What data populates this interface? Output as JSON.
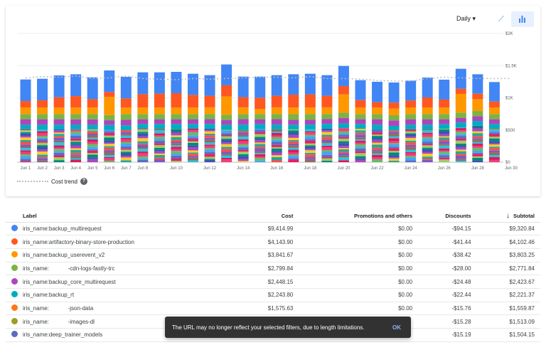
{
  "controls": {
    "granularity": "Daily",
    "line_view": "line-chart-icon",
    "bar_view": "bar-chart-icon",
    "active_view": "bar"
  },
  "chart_data": {
    "type": "bar",
    "stacked": true,
    "categories": [
      "Jun 1",
      "Jun 2",
      "Jun 3",
      "Jun 4",
      "Jun 5",
      "Jun 6",
      "Jun 7",
      "Jun 8",
      "Jun 9",
      "Jun 10",
      "Jun 11",
      "Jun 12",
      "Jun 13",
      "Jun 14",
      "Jun 15",
      "Jun 16",
      "Jun 17",
      "Jun 18",
      "Jun 19",
      "Jun 20",
      "Jun 21",
      "Jun 22",
      "Jun 23",
      "Jun 24",
      "Jun 25",
      "Jun 26",
      "Jun 27",
      "Jun 28",
      "Jun 29"
    ],
    "x_tick_labels": [
      "Jun 1",
      "Jun 2",
      "Jun 3",
      "Jun 4",
      "Jun 5",
      "Jun 6",
      "Jun 7",
      "Jun 8",
      "Jun 10",
      "Jun 12",
      "Jun 14",
      "Jun 16",
      "Jun 18",
      "Jun 20",
      "Jun 22",
      "Jun 24",
      "Jun 26",
      "Jun 28",
      "Jun 30"
    ],
    "y_ticks": [
      0,
      500,
      1000,
      1500,
      2000
    ],
    "y_tick_labels": [
      "$0",
      "$500",
      "$1K",
      "$1.5K",
      "$2K"
    ],
    "ylim": [
      0,
      2000
    ],
    "grid": true,
    "y_axis_side": "right",
    "series": [
      {
        "name": "iris_name:backup_multirequest",
        "color": "#4285f4",
        "values": [
          335,
          335,
          339,
          339,
          339,
          335,
          335,
          339,
          331,
          331,
          328,
          320,
          324,
          320,
          328,
          320,
          317,
          320,
          320,
          313,
          309,
          317,
          313,
          309,
          309,
          309,
          309,
          302,
          302
        ]
      },
      {
        "name": "iris_name:artifactory-binary-store-production",
        "color": "#ff5722",
        "values": [
          99,
          110,
          158,
          177,
          129,
          74,
          140,
          206,
          214,
          221,
          195,
          180,
          173,
          158,
          173,
          180,
          199,
          203,
          180,
          129,
          114,
          81,
          92,
          107,
          155,
          122,
          81,
          85,
          92
        ]
      },
      {
        "name": "iris_name:backup_userevent_v2",
        "color": "#ff9800",
        "values": [
          103,
          103,
          103,
          103,
          103,
          284,
          103,
          103,
          103,
          103,
          103,
          103,
          284,
          103,
          81,
          103,
          103,
          103,
          103,
          284,
          103,
          103,
          103,
          103,
          103,
          103,
          291,
          184,
          103
        ]
      },
      {
        "name": "iris_name:cdn-logs-fastly-trc",
        "color": "#7cb342",
        "values": [
          81,
          81,
          81,
          81,
          81,
          81,
          90,
          81,
          81,
          81,
          81,
          81,
          81,
          81,
          81,
          81,
          90,
          90,
          81,
          81,
          81,
          81,
          81,
          81,
          81,
          81,
          81,
          81,
          81
        ]
      },
      {
        "name": "iris_name:backup_core_multirequest",
        "color": "#ab47bc",
        "values": [
          85,
          85,
          85,
          85,
          85,
          74,
          85,
          74,
          74,
          74,
          74,
          74,
          74,
          85,
          74,
          85,
          74,
          74,
          74,
          85,
          74,
          85,
          85,
          85,
          85,
          74,
          74,
          74,
          74
        ]
      },
      {
        "name": "iris_name:backup_rt",
        "color": "#00acc1",
        "values": [
          74,
          74,
          74,
          74,
          74,
          74,
          74,
          74,
          74,
          74,
          74,
          74,
          74,
          74,
          74,
          74,
          74,
          74,
          74,
          74,
          74,
          74,
          74,
          74,
          74,
          74,
          74,
          74,
          74
        ]
      },
      {
        "values": [
          508,
          508,
          508,
          507,
          507,
          503,
          499,
          519,
          519,
          519,
          519,
          520,
          508,
          509,
          519,
          509,
          509,
          510,
          520,
          529,
          519,
          508,
          490,
          508,
          508,
          519,
          541,
          566,
          519
        ]
      }
    ],
    "trend": {
      "name": "Cost trend",
      "values": [
        1310,
        1330,
        1320,
        1340,
        1300,
        1310,
        1340,
        1300,
        1290,
        1280,
        1300,
        1290,
        1300,
        1310,
        1320,
        1320,
        1310,
        1330,
        1300,
        1300,
        1290,
        1270,
        1260,
        1260,
        1300,
        1320,
        1310,
        1300,
        1300,
        1300
      ]
    }
  },
  "legend": {
    "trend_label": "Cost trend",
    "help_icon": "help-icon"
  },
  "table": {
    "headers": {
      "label": "Label",
      "cost": "Cost",
      "promotions": "Promotions and others",
      "discounts": "Discounts",
      "subtotal": "Subtotal",
      "sort_icon": "↓"
    },
    "rows": [
      {
        "color": "#4285f4",
        "label": "iris_name:backup_multirequest",
        "cost": "$9,414.99",
        "promotions": "$0.00",
        "discounts": "-$94.15",
        "subtotal": "$9,320.84"
      },
      {
        "color": "#ff5722",
        "label": "iris_name:artifactory-binary-store-production",
        "cost": "$4,143.90",
        "promotions": "$0.00",
        "discounts": "-$41.44",
        "subtotal": "$4,102.46"
      },
      {
        "color": "#ff9800",
        "label": "iris_name:backup_userevent_v2",
        "cost": "$3,841.67",
        "promotions": "$0.00",
        "discounts": "-$38.42",
        "subtotal": "$3,803.25"
      },
      {
        "color": "#7cb342",
        "label": "iris_name:            -cdn-logs-fastly-trc",
        "cost": "$2,799.84",
        "promotions": "$0.00",
        "discounts": "-$28.00",
        "subtotal": "$2,771.84"
      },
      {
        "color": "#ab47bc",
        "label": "iris_name:backup_core_multirequest",
        "cost": "$2,448.15",
        "promotions": "$0.00",
        "discounts": "-$24.48",
        "subtotal": "$2,423.67"
      },
      {
        "color": "#00acc1",
        "label": "iris_name:backup_rt",
        "cost": "$2,243.80",
        "promotions": "$0.00",
        "discounts": "-$22.44",
        "subtotal": "$2,221.37"
      },
      {
        "color": "#ff7518",
        "label": "iris_name:            -json-data",
        "cost": "$1,575.63",
        "promotions": "$0.00",
        "discounts": "-$15.76",
        "subtotal": "$1,559.87"
      },
      {
        "color": "#9e9d24",
        "label": "iris_name:            -images-dl",
        "cost": "",
        "promotions": "",
        "discounts": "-$15.28",
        "subtotal": "$1,513.09"
      },
      {
        "color": "#5c6bc0",
        "label": "iris_name:deep_trainer_models",
        "cost": "",
        "promotions": "",
        "discounts": "-$15.19",
        "subtotal": "$1,504.15"
      }
    ]
  },
  "toast": {
    "message": "The URL may no longer reflect your selected filters, due to length limitations.",
    "action": "OK"
  }
}
